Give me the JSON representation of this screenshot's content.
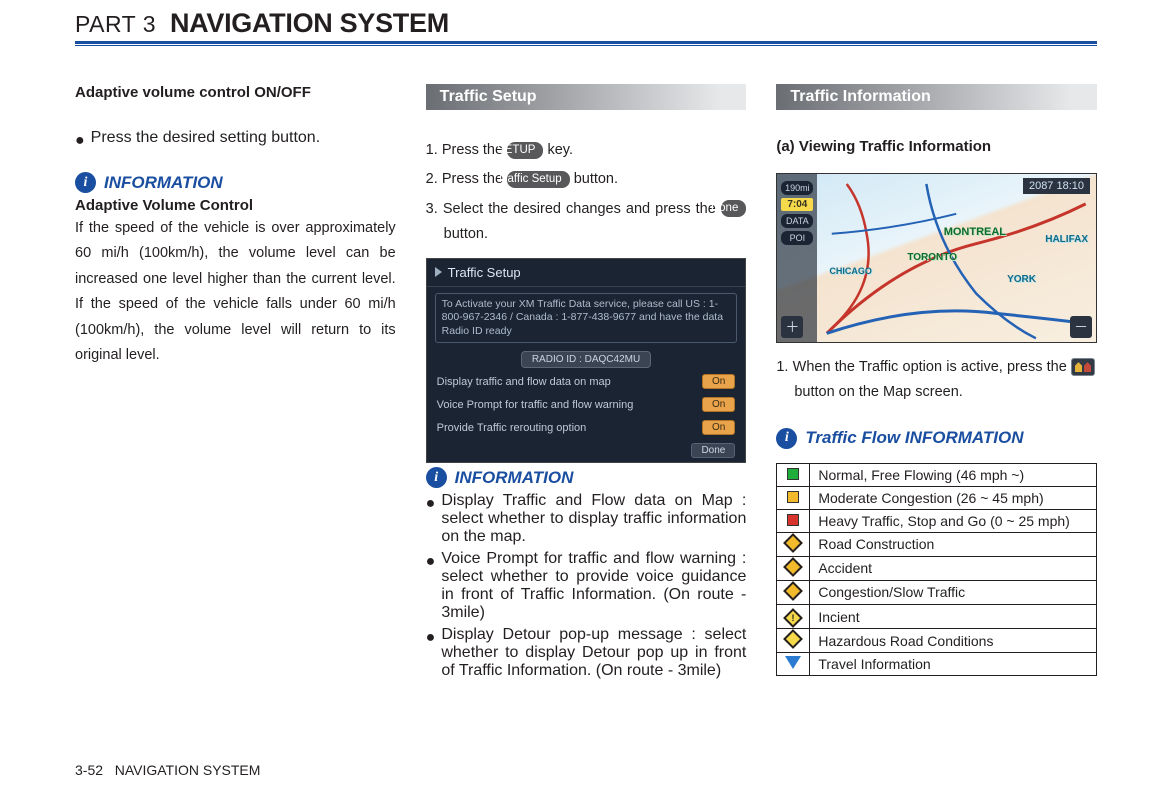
{
  "header": {
    "part": "PART 3",
    "title": "NAVIGATION SYSTEM"
  },
  "footer": {
    "page": "3-52",
    "section": "NAVIGATION SYSTEM"
  },
  "col1": {
    "heading": "Adaptive volume control ON/OFF",
    "bullet": "Press the desired setting button.",
    "info_label": "INFORMATION",
    "avc_title": "Adaptive Volume Control",
    "avc_body": "If the speed of the vehicle is over approximately 60 mi/h (100km/h), the volume level can be increased one level higher than the current level. If the speed of the vehicle falls under 60 mi/h (100km/h), the volume level will return to its original level."
  },
  "col2": {
    "section": "Traffic Setup",
    "keys": {
      "setup": "SETUP",
      "traffic_setup": "Traffic Setup",
      "done": "Done"
    },
    "step1a": "Press the ",
    "step1b": " key.",
    "step2a": "Press the ",
    "step2b": " button.",
    "step3a": "Select the desired changes and press the ",
    "step3b": " button.",
    "screenshot": {
      "title": "Traffic Setup",
      "activate": "To Activate your XM Traffic Data service, please call\nUS : 1-800-967-2346 / Canada : 1-877-438-9677\nand have the data Radio ID ready",
      "radio": "RADIO ID : DAQC42MU",
      "rows": [
        {
          "label": "Display traffic and flow data on map",
          "btn": "On"
        },
        {
          "label": "Voice Prompt for traffic and flow warning",
          "btn": "On"
        },
        {
          "label": "Provide Traffic rerouting option",
          "btn": "On"
        }
      ],
      "done": "Done"
    },
    "info_label": "INFORMATION",
    "bullets": [
      "Display Traffic and Flow data on Map : select whether to display traffic information on the map.",
      "Voice Prompt for traffic and flow warning : select whether to provide voice guidance in front of Traffic Information. (On route - 3mile)",
      "Display Detour pop-up message : select whether to display Detour pop up in front of Traffic Information. (On route - 3mile)"
    ]
  },
  "col3": {
    "section": "Traffic Information",
    "sub": "(a) Viewing Traffic Information",
    "map": {
      "clock": "2087  18:10",
      "dist": "190mi",
      "time": "7:04",
      "data": "DATA",
      "poi": "POI",
      "montreal": "MONTREAL",
      "toronto": "TORONTO",
      "halifax": "HALIFAX",
      "york": "YORK",
      "chicago": "CHICAGO"
    },
    "step1a": "When the Traffic option is active, press the ",
    "step1b": " button on the Map screen.",
    "flow_label": "Traffic Flow INFORMATION",
    "legend": [
      {
        "kind": "sq",
        "color": "#1fae3b",
        "text": "Normal, Free Flowing (46 mph ~)"
      },
      {
        "kind": "sq",
        "color": "#f2b92a",
        "text": "Moderate Congestion (26 ~ 45 mph)"
      },
      {
        "kind": "sq",
        "color": "#d6342b",
        "text": "Heavy Traffic, Stop and Go (0 ~ 25 mph)"
      },
      {
        "kind": "diam",
        "fill": "#f2b92a",
        "glyph": "",
        "text": "Road Construction"
      },
      {
        "kind": "diam",
        "fill": "#f2b92a",
        "glyph": "",
        "text": "Accident"
      },
      {
        "kind": "diam",
        "fill": "#f2b92a",
        "glyph": "",
        "text": "Congestion/Slow Traffic"
      },
      {
        "kind": "diam",
        "fill": "#f6d94a",
        "glyph": "!",
        "text": "Incient"
      },
      {
        "kind": "diam",
        "fill": "#f6d94a",
        "glyph": "",
        "text": "Hazardous Road Conditions"
      },
      {
        "kind": "tri",
        "fill": "#2a7bd1",
        "text": "Travel Information"
      }
    ]
  }
}
